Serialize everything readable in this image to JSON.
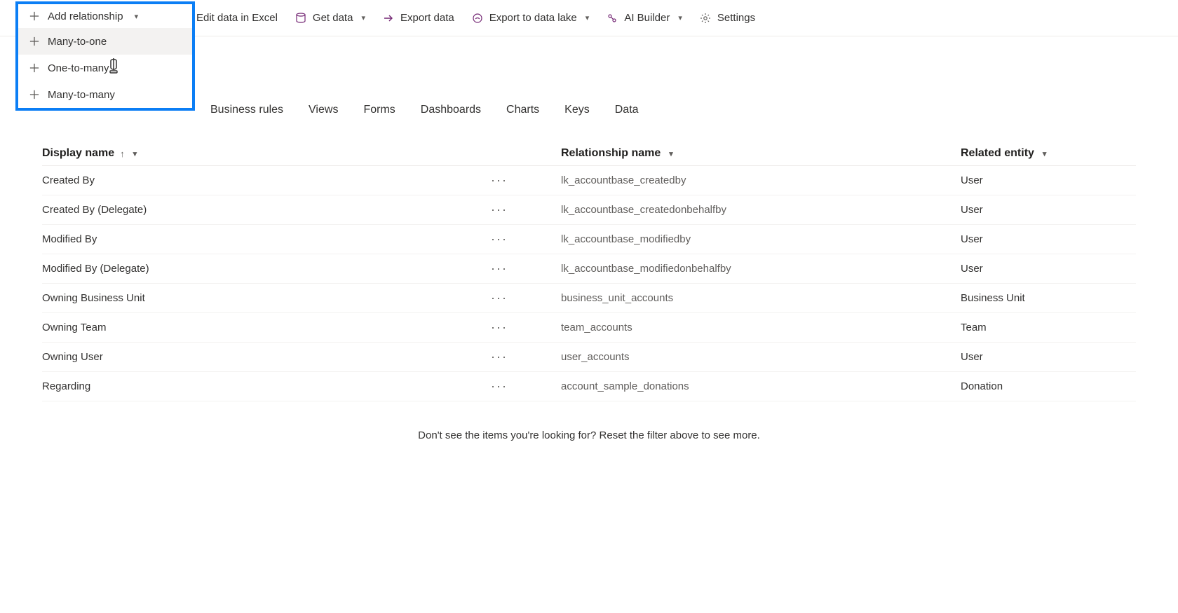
{
  "toolbar": {
    "add_relationship": "Add relationship",
    "edit_excel": "Edit data in Excel",
    "get_data": "Get data",
    "export_data": "Export data",
    "export_lake": "Export to data lake",
    "ai_builder": "AI Builder",
    "settings": "Settings"
  },
  "dropdown": {
    "items": [
      {
        "label": "Many-to-one"
      },
      {
        "label": "One-to-many"
      },
      {
        "label": "Many-to-many"
      }
    ]
  },
  "tabs": [
    "Business rules",
    "Views",
    "Forms",
    "Dashboards",
    "Charts",
    "Keys",
    "Data"
  ],
  "columns": {
    "display_name": "Display name",
    "relationship_name": "Relationship name",
    "related_entity": "Related entity"
  },
  "rows": [
    {
      "name": "Created By",
      "rel": "lk_accountbase_createdby",
      "entity": "User"
    },
    {
      "name": "Created By (Delegate)",
      "rel": "lk_accountbase_createdonbehalfby",
      "entity": "User"
    },
    {
      "name": "Modified By",
      "rel": "lk_accountbase_modifiedby",
      "entity": "User"
    },
    {
      "name": "Modified By (Delegate)",
      "rel": "lk_accountbase_modifiedonbehalfby",
      "entity": "User"
    },
    {
      "name": "Owning Business Unit",
      "rel": "business_unit_accounts",
      "entity": "Business Unit"
    },
    {
      "name": "Owning Team",
      "rel": "team_accounts",
      "entity": "Team"
    },
    {
      "name": "Owning User",
      "rel": "user_accounts",
      "entity": "User"
    },
    {
      "name": "Regarding",
      "rel": "account_sample_donations",
      "entity": "Donation"
    }
  ],
  "footer": "Don't see the items you're looking for? Reset the filter above to see more."
}
